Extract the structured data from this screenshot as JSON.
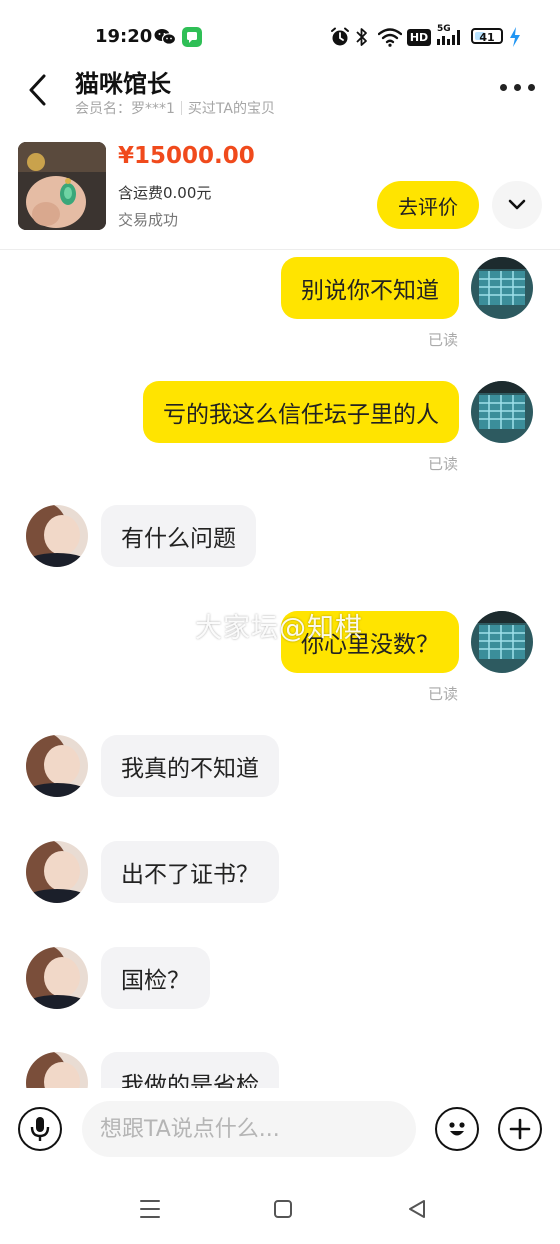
{
  "status_bar": {
    "time": "19:20",
    "icons": [
      "wechat-icon",
      "messages-app-icon",
      "alarm-icon",
      "bluetooth-icon",
      "wifi-icon",
      "hd-icon",
      "signal-5g-icon",
      "battery-icon",
      "charging-icon"
    ],
    "hd_label": "HD",
    "network_label": "5G",
    "battery_level": 41
  },
  "header": {
    "title": "猫咪馆长",
    "member_label": "会员名：罗***1",
    "purchase_note": "买过TA的宝贝"
  },
  "product": {
    "price": "¥15000.00",
    "shipping": "含运费0.00元",
    "status": "交易成功",
    "review_button": "去评价"
  },
  "messages": [
    {
      "side": "mine",
      "text": "别说你不知道",
      "read": "已读"
    },
    {
      "side": "mine",
      "text": "亏的我这么信任坛子里的人",
      "read": "已读"
    },
    {
      "side": "theirs",
      "text": "有什么问题"
    },
    {
      "side": "mine",
      "text": "你心里没数？",
      "read": "已读"
    },
    {
      "side": "theirs",
      "text": "我真的不知道"
    },
    {
      "side": "theirs",
      "text": "出不了证书？"
    },
    {
      "side": "theirs",
      "text": "国检？"
    },
    {
      "side": "theirs",
      "text": "我做的是省检"
    }
  ],
  "watermark": "大家坛@知棋",
  "input": {
    "placeholder": "想跟TA说点什么..."
  },
  "colors": {
    "accent_yellow": "#ffe400",
    "price_red": "#f04a1c",
    "bubble_grey": "#f3f3f5",
    "read_grey": "#aaaaaa"
  }
}
